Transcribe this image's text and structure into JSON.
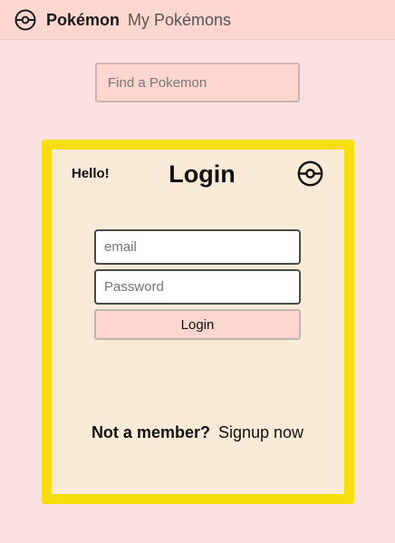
{
  "navbar": {
    "logo_icon": "pokeball-icon",
    "brand": "Pokémon",
    "link_my_pokemons": "My Pokémons"
  },
  "search": {
    "placeholder": "Find a Pokemon"
  },
  "login_card": {
    "greeting": "Hello!",
    "title": "Login",
    "logo_icon": "pokeball-icon",
    "email_placeholder": "email",
    "password_placeholder": "Password",
    "submit_label": "Login",
    "not_member_text": "Not a member?",
    "signup_link": "Signup now"
  },
  "colors": {
    "page_background": "#fde1e1",
    "navbar_background": "#fdd6d0",
    "card_border": "#f6de0d",
    "card_background": "#faead8",
    "button_background": "#fdd6d0"
  }
}
